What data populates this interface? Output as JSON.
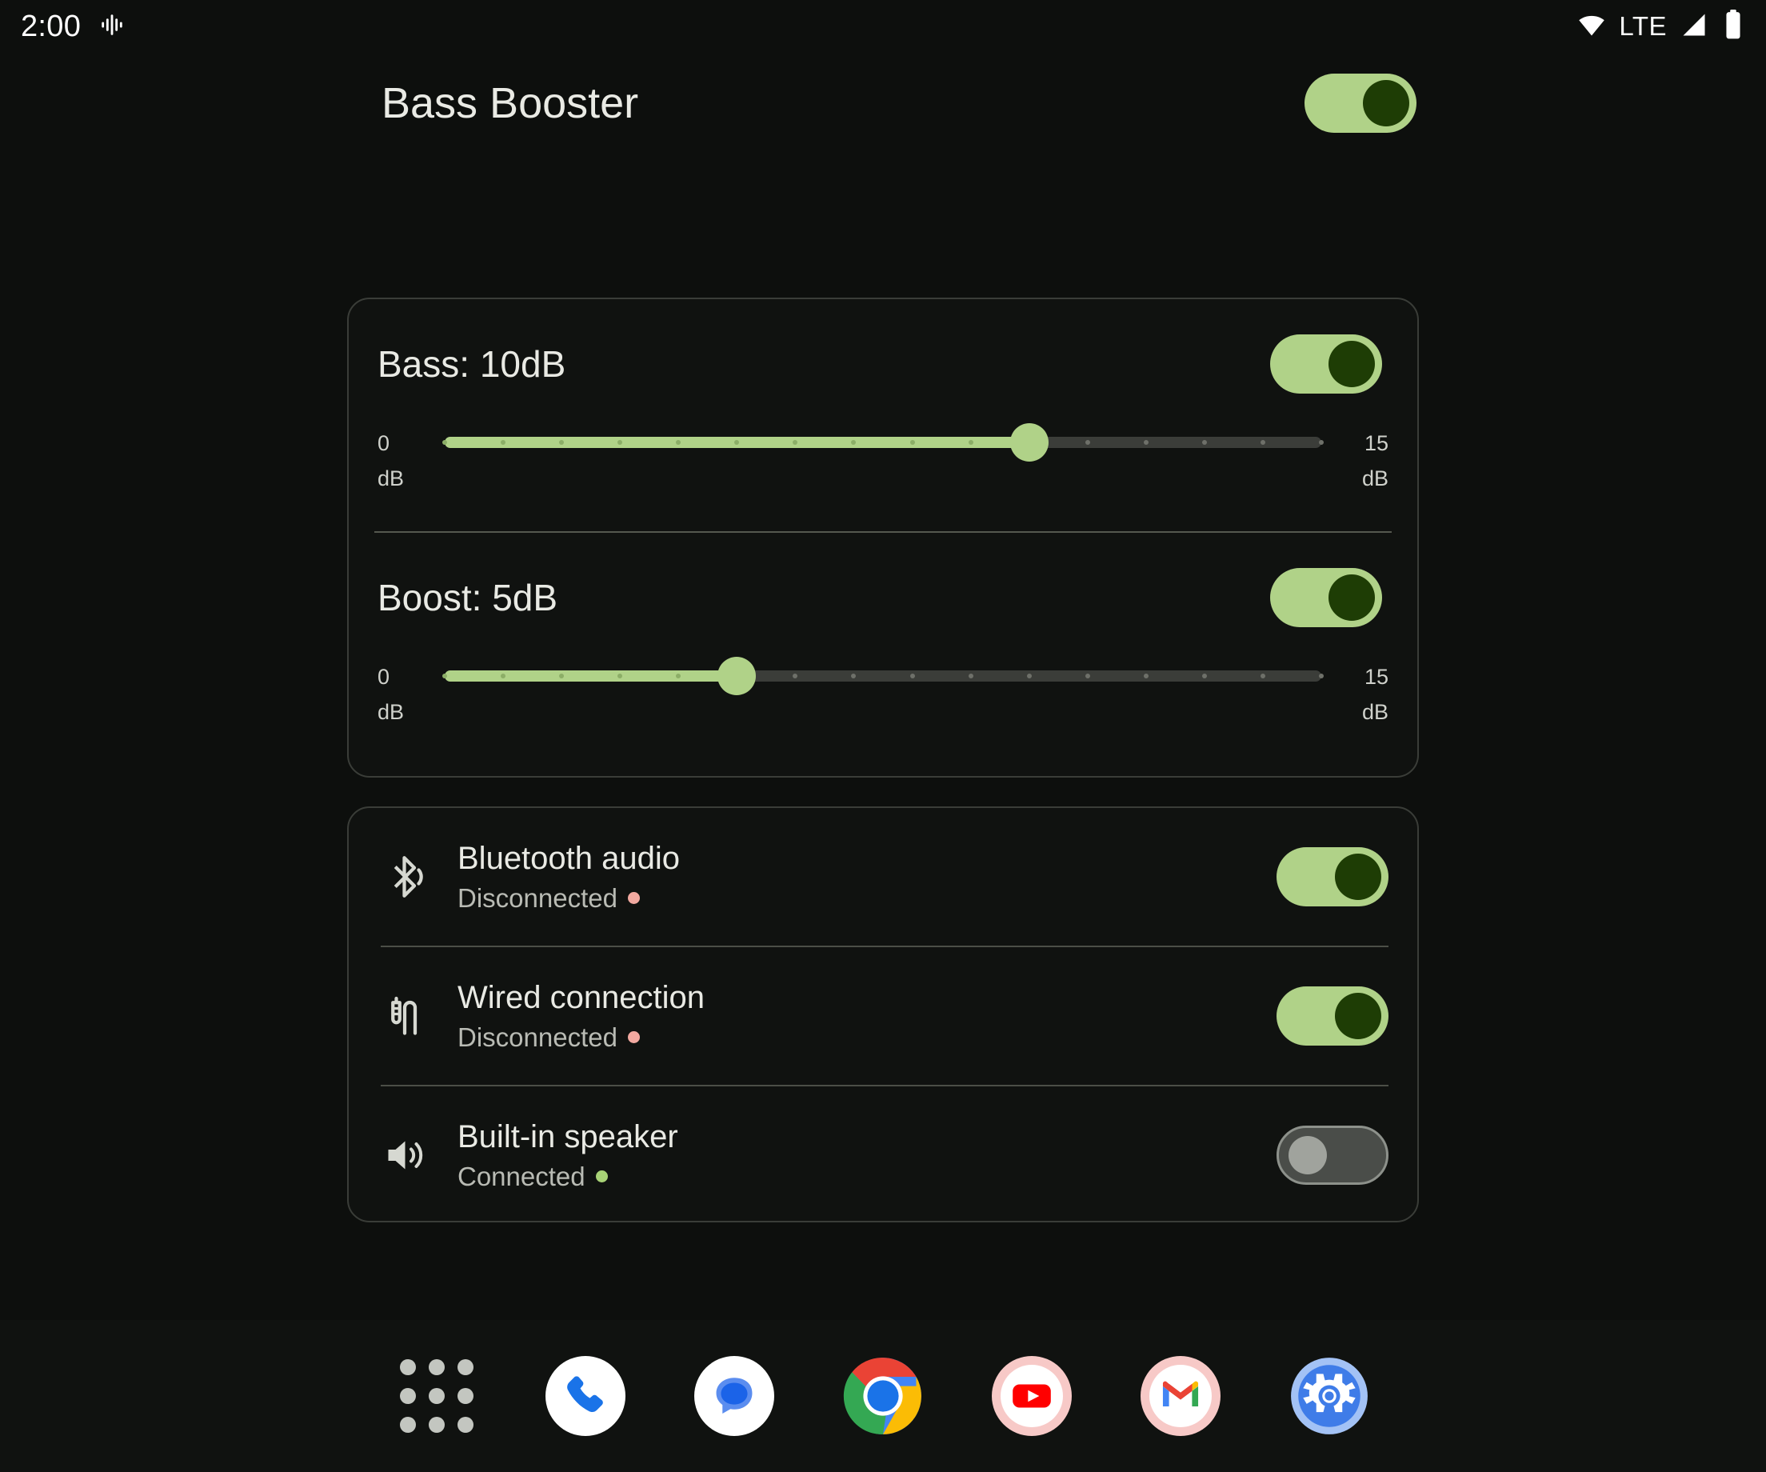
{
  "statusbar": {
    "time": "2:00",
    "audio_icon": "audio-waveform-icon",
    "wifi_icon": "wifi-icon",
    "network_label": "LTE",
    "signal_icon": "cellular-signal-icon",
    "battery_icon": "battery-full-icon"
  },
  "header": {
    "title": "Bass Booster",
    "master_toggle_state": "on"
  },
  "sliders": [
    {
      "label": "Bass: 10dB",
      "name": "Bass",
      "value": 10,
      "min": 0,
      "max": 15,
      "min_label_value": "0",
      "min_label_unit": "dB",
      "max_label_value": "15",
      "max_label_unit": "dB",
      "toggle_state": "on"
    },
    {
      "label": "Boost: 5dB",
      "name": "Boost",
      "value": 5,
      "min": 0,
      "max": 15,
      "min_label_value": "0",
      "min_label_unit": "dB",
      "max_label_value": "15",
      "max_label_unit": "dB",
      "toggle_state": "on"
    }
  ],
  "outputs": [
    {
      "icon": "bluetooth-audio-icon",
      "title": "Bluetooth audio",
      "status": "Disconnected",
      "status_dot": "red",
      "toggle_state": "on"
    },
    {
      "icon": "headphone-jack-icon",
      "title": "Wired connection",
      "status": "Disconnected",
      "status_dot": "red",
      "toggle_state": "on"
    },
    {
      "icon": "speaker-volume-icon",
      "title": "Built-in speaker",
      "status": "Connected",
      "status_dot": "green",
      "toggle_state": "off"
    }
  ],
  "dock": [
    {
      "name": "app-drawer",
      "label": "All apps"
    },
    {
      "name": "phone",
      "label": "Phone"
    },
    {
      "name": "messages",
      "label": "Messages"
    },
    {
      "name": "chrome",
      "label": "Chrome"
    },
    {
      "name": "youtube",
      "label": "YouTube"
    },
    {
      "name": "gmail",
      "label": "Gmail"
    },
    {
      "name": "settings",
      "label": "Settings"
    }
  ],
  "colors": {
    "background": "#0d0f0d",
    "accent_green": "#b0d288",
    "thumb_dark_green": "#1e3d05",
    "text_primary": "#e9eae4",
    "text_secondary": "#b9bbb4",
    "status_red": "#f2a9a0",
    "status_green": "#a8d276",
    "card_border": "#3a3d38",
    "track_inactive": "#3b3d39"
  }
}
